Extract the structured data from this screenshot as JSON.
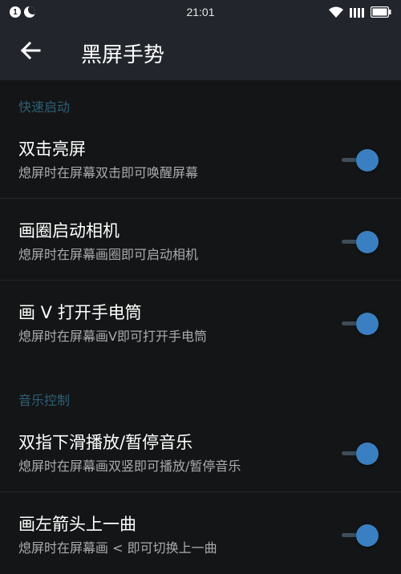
{
  "status_bar": {
    "time": "21:01",
    "notification_badge": "1",
    "icons": [
      "notification-badge-icon",
      "moon-icon",
      "wifi-icon",
      "signal-icon",
      "battery-icon"
    ]
  },
  "header": {
    "title": "黑屏手势",
    "back_icon": "arrow-left-icon"
  },
  "sections": [
    {
      "header": "快速启动",
      "items": [
        {
          "title": "双击亮屏",
          "subtitle": "熄屏时在屏幕双击即可唤醒屏幕",
          "enabled": true
        },
        {
          "title": "画圈启动相机",
          "subtitle": "熄屏时在屏幕画圈即可启动相机",
          "enabled": true
        },
        {
          "title": "画 V 打开手电筒",
          "subtitle": "熄屏时在屏幕画V即可打开手电筒",
          "enabled": true
        }
      ]
    },
    {
      "header": "音乐控制",
      "items": [
        {
          "title": "双指下滑播放/暂停音乐",
          "subtitle": "熄屏时在屏幕画双竖即可播放/暂停音乐",
          "enabled": true
        },
        {
          "title": "画左箭头上一曲",
          "subtitle": "熄屏时在屏幕画 < 即可切换上一曲",
          "enabled": true
        }
      ]
    }
  ],
  "colors": {
    "background": "#141516",
    "app_bar": "#22262c",
    "section_header": "#2e5f74",
    "subtitle": "#a9abad",
    "toggle_on": "#3a7fc1",
    "toggle_track": "#3d4e5a"
  }
}
